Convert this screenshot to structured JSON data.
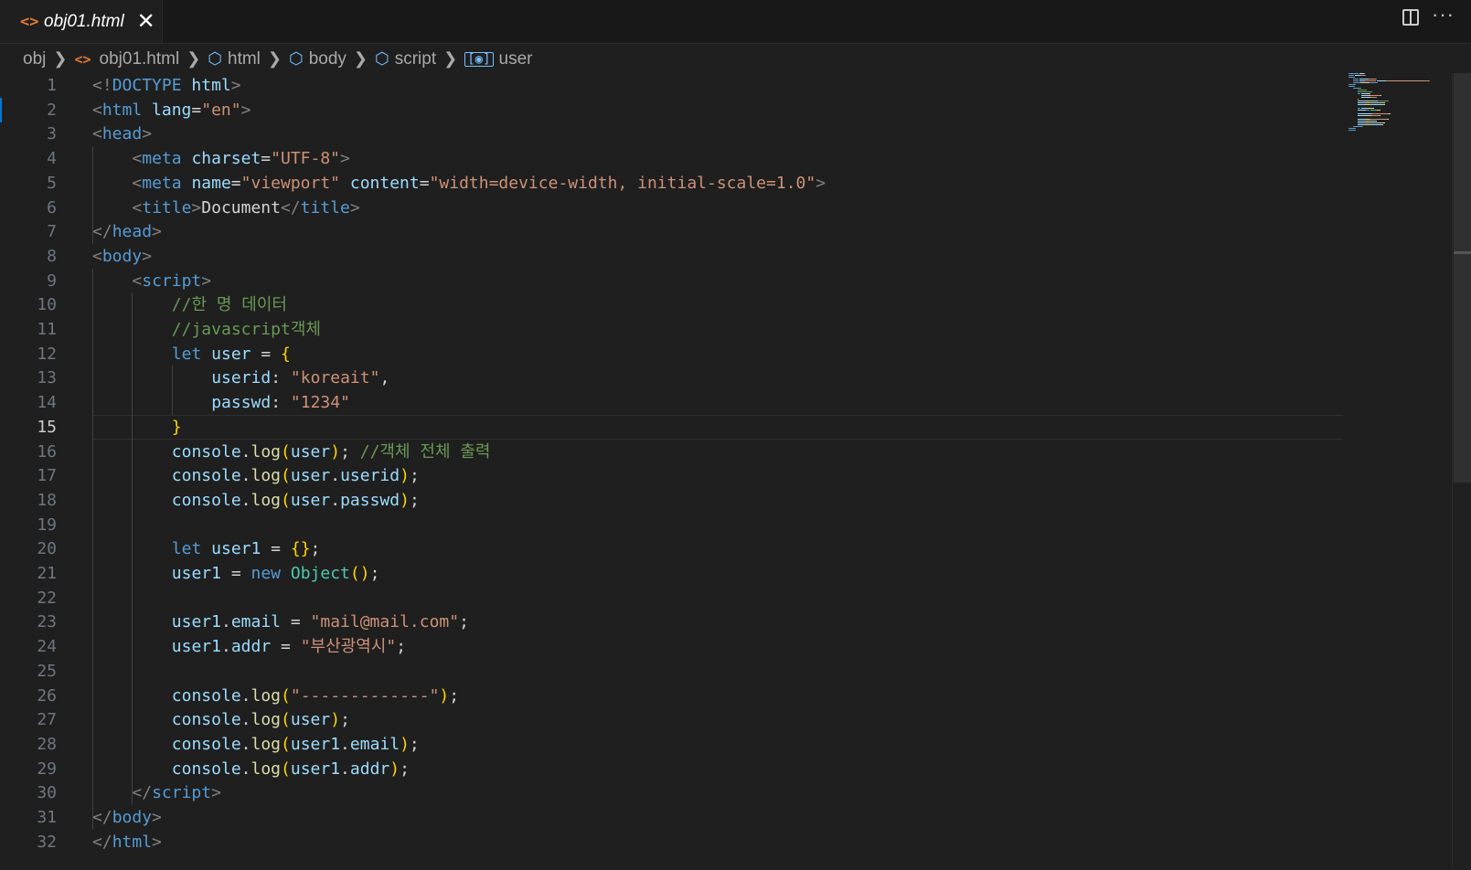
{
  "tab": {
    "icon": "html-file-icon",
    "title": "obj01.html",
    "close_label": "✕"
  },
  "actions": {
    "split": "split-editor-icon",
    "more": "···"
  },
  "breadcrumb": [
    {
      "label": "obj",
      "icon": ""
    },
    {
      "label": "obj01.html",
      "icon": "html-file-icon"
    },
    {
      "label": "html",
      "icon": "symbol-box-icon"
    },
    {
      "label": "body",
      "icon": "symbol-box-icon"
    },
    {
      "label": "script",
      "icon": "symbol-box-icon"
    },
    {
      "label": "user",
      "icon": "symbol-variable-icon"
    }
  ],
  "active_line": 15,
  "colors": {
    "accent": "#0078d4",
    "tag": "#569cd6",
    "attr": "#9cdcfe",
    "string": "#ce9178",
    "comment": "#6a9955",
    "function": "#dcdcaa",
    "bracket": "#ffd700",
    "class": "#4ec9b0",
    "background": "#1f1f1f"
  },
  "code_lines": [
    {
      "n": "1",
      "indent": 0,
      "tokens": [
        [
          "p",
          "<!"
        ],
        [
          "t",
          "DOCTYPE"
        ],
        [
          "w",
          " "
        ],
        [
          "a",
          "html"
        ],
        [
          "p",
          ">"
        ]
      ]
    },
    {
      "n": "2",
      "indent": 0,
      "tokens": [
        [
          "p",
          "<"
        ],
        [
          "t",
          "html"
        ],
        [
          "w",
          " "
        ],
        [
          "a",
          "lang"
        ],
        [
          "w",
          "="
        ],
        [
          "s",
          "\"en\""
        ],
        [
          "p",
          ">"
        ]
      ]
    },
    {
      "n": "3",
      "indent": 0,
      "tokens": [
        [
          "p",
          "<"
        ],
        [
          "t",
          "head"
        ],
        [
          "p",
          ">"
        ]
      ]
    },
    {
      "n": "4",
      "indent": 4,
      "tokens": [
        [
          "p",
          "<"
        ],
        [
          "t",
          "meta"
        ],
        [
          "w",
          " "
        ],
        [
          "a",
          "charset"
        ],
        [
          "w",
          "="
        ],
        [
          "s",
          "\"UTF-8\""
        ],
        [
          "p",
          ">"
        ]
      ]
    },
    {
      "n": "5",
      "indent": 4,
      "tokens": [
        [
          "p",
          "<"
        ],
        [
          "t",
          "meta"
        ],
        [
          "w",
          " "
        ],
        [
          "a",
          "name"
        ],
        [
          "w",
          "="
        ],
        [
          "s",
          "\"viewport\""
        ],
        [
          "w",
          " "
        ],
        [
          "a",
          "content"
        ],
        [
          "w",
          "="
        ],
        [
          "s",
          "\"width=device-width, initial-scale=1.0\""
        ],
        [
          "p",
          ">"
        ]
      ]
    },
    {
      "n": "6",
      "indent": 4,
      "tokens": [
        [
          "p",
          "<"
        ],
        [
          "t",
          "title"
        ],
        [
          "p",
          ">"
        ],
        [
          "w",
          "Document"
        ],
        [
          "p",
          "</"
        ],
        [
          "t",
          "title"
        ],
        [
          "p",
          ">"
        ]
      ]
    },
    {
      "n": "7",
      "indent": 0,
      "tokens": [
        [
          "p",
          "</"
        ],
        [
          "t",
          "head"
        ],
        [
          "p",
          ">"
        ]
      ]
    },
    {
      "n": "8",
      "indent": 0,
      "tokens": [
        [
          "p",
          "<"
        ],
        [
          "t",
          "body"
        ],
        [
          "p",
          ">"
        ]
      ]
    },
    {
      "n": "9",
      "indent": 4,
      "tokens": [
        [
          "p",
          "<"
        ],
        [
          "t",
          "script"
        ],
        [
          "p",
          ">"
        ]
      ]
    },
    {
      "n": "10",
      "indent": 8,
      "tokens": [
        [
          "c",
          "//한 명 데이터"
        ]
      ]
    },
    {
      "n": "11",
      "indent": 8,
      "tokens": [
        [
          "c",
          "//javascript객체"
        ]
      ]
    },
    {
      "n": "12",
      "indent": 8,
      "tokens": [
        [
          "k",
          "let"
        ],
        [
          "w",
          " "
        ],
        [
          "v",
          "user"
        ],
        [
          "w",
          " = "
        ],
        [
          "b",
          "{"
        ]
      ]
    },
    {
      "n": "13",
      "indent": 12,
      "tokens": [
        [
          "v",
          "userid"
        ],
        [
          "w",
          ": "
        ],
        [
          "s",
          "\"koreait\""
        ],
        [
          "w",
          ","
        ]
      ]
    },
    {
      "n": "14",
      "indent": 12,
      "tokens": [
        [
          "v",
          "passwd"
        ],
        [
          "w",
          ": "
        ],
        [
          "s",
          "\"1234\""
        ]
      ]
    },
    {
      "n": "15",
      "indent": 8,
      "tokens": [
        [
          "b",
          "}"
        ]
      ]
    },
    {
      "n": "16",
      "indent": 8,
      "tokens": [
        [
          "v",
          "console"
        ],
        [
          "w",
          "."
        ],
        [
          "f",
          "log"
        ],
        [
          "b",
          "("
        ],
        [
          "v",
          "user"
        ],
        [
          "b",
          ")"
        ],
        [
          "w",
          "; "
        ],
        [
          "c",
          "//객체 전체 출력"
        ]
      ]
    },
    {
      "n": "17",
      "indent": 8,
      "tokens": [
        [
          "v",
          "console"
        ],
        [
          "w",
          "."
        ],
        [
          "f",
          "log"
        ],
        [
          "b",
          "("
        ],
        [
          "v",
          "user"
        ],
        [
          "w",
          "."
        ],
        [
          "v",
          "userid"
        ],
        [
          "b",
          ")"
        ],
        [
          "w",
          ";"
        ]
      ]
    },
    {
      "n": "18",
      "indent": 8,
      "tokens": [
        [
          "v",
          "console"
        ],
        [
          "w",
          "."
        ],
        [
          "f",
          "log"
        ],
        [
          "b",
          "("
        ],
        [
          "v",
          "user"
        ],
        [
          "w",
          "."
        ],
        [
          "v",
          "passwd"
        ],
        [
          "b",
          ")"
        ],
        [
          "w",
          ";"
        ]
      ]
    },
    {
      "n": "19",
      "indent": 0,
      "tokens": []
    },
    {
      "n": "20",
      "indent": 8,
      "tokens": [
        [
          "k",
          "let"
        ],
        [
          "w",
          " "
        ],
        [
          "v",
          "user1"
        ],
        [
          "w",
          " = "
        ],
        [
          "b",
          "{}"
        ],
        [
          "w",
          ";"
        ]
      ]
    },
    {
      "n": "21",
      "indent": 8,
      "tokens": [
        [
          "v",
          "user1"
        ],
        [
          "w",
          " = "
        ],
        [
          "k",
          "new"
        ],
        [
          "w",
          " "
        ],
        [
          "cl",
          "Object"
        ],
        [
          "b",
          "()"
        ],
        [
          "w",
          ";"
        ]
      ]
    },
    {
      "n": "22",
      "indent": 0,
      "tokens": []
    },
    {
      "n": "23",
      "indent": 8,
      "tokens": [
        [
          "v",
          "user1"
        ],
        [
          "w",
          "."
        ],
        [
          "v",
          "email"
        ],
        [
          "w",
          " = "
        ],
        [
          "s",
          "\"mail@mail.com\""
        ],
        [
          "w",
          ";"
        ]
      ]
    },
    {
      "n": "24",
      "indent": 8,
      "tokens": [
        [
          "v",
          "user1"
        ],
        [
          "w",
          "."
        ],
        [
          "v",
          "addr"
        ],
        [
          "w",
          " = "
        ],
        [
          "s",
          "\"부산광역시\""
        ],
        [
          "w",
          ";"
        ]
      ]
    },
    {
      "n": "25",
      "indent": 0,
      "tokens": []
    },
    {
      "n": "26",
      "indent": 8,
      "tokens": [
        [
          "v",
          "console"
        ],
        [
          "w",
          "."
        ],
        [
          "f",
          "log"
        ],
        [
          "b",
          "("
        ],
        [
          "s",
          "\"-------------\""
        ],
        [
          "b",
          ")"
        ],
        [
          "w",
          ";"
        ]
      ]
    },
    {
      "n": "27",
      "indent": 8,
      "tokens": [
        [
          "v",
          "console"
        ],
        [
          "w",
          "."
        ],
        [
          "f",
          "log"
        ],
        [
          "b",
          "("
        ],
        [
          "v",
          "user"
        ],
        [
          "b",
          ")"
        ],
        [
          "w",
          ";"
        ]
      ]
    },
    {
      "n": "28",
      "indent": 8,
      "tokens": [
        [
          "v",
          "console"
        ],
        [
          "w",
          "."
        ],
        [
          "f",
          "log"
        ],
        [
          "b",
          "("
        ],
        [
          "v",
          "user1"
        ],
        [
          "w",
          "."
        ],
        [
          "v",
          "email"
        ],
        [
          "b",
          ")"
        ],
        [
          "w",
          ";"
        ]
      ]
    },
    {
      "n": "29",
      "indent": 8,
      "tokens": [
        [
          "v",
          "console"
        ],
        [
          "w",
          "."
        ],
        [
          "f",
          "log"
        ],
        [
          "b",
          "("
        ],
        [
          "v",
          "user1"
        ],
        [
          "w",
          "."
        ],
        [
          "v",
          "addr"
        ],
        [
          "b",
          ")"
        ],
        [
          "w",
          ";"
        ]
      ]
    },
    {
      "n": "30",
      "indent": 4,
      "tokens": [
        [
          "p",
          "</"
        ],
        [
          "t",
          "script"
        ],
        [
          "p",
          ">"
        ]
      ]
    },
    {
      "n": "31",
      "indent": 0,
      "tokens": [
        [
          "p",
          "</"
        ],
        [
          "t",
          "body"
        ],
        [
          "p",
          ">"
        ]
      ]
    },
    {
      "n": "32",
      "indent": 0,
      "tokens": [
        [
          "p",
          "</"
        ],
        [
          "t",
          "html"
        ],
        [
          "p",
          ">"
        ]
      ]
    }
  ]
}
